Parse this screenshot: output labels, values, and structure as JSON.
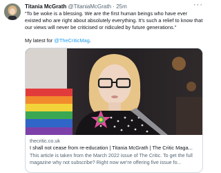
{
  "tweet": {
    "author_name": "Titania McGrath",
    "author_handle": "@TitaniaMcGrath",
    "separator": "·",
    "time": "25m",
    "more_icon": "more-horizontal-icon",
    "text_paragraph_1": "“To be woke is a blessing. We are the first human beings who have ever existed who are right about absolutely everything. It’s such a relief to know that our views will never be criticised or ridiculed by future generations.”",
    "text_prefix": "My latest for ",
    "mention": "@TheCriticMag",
    "text_suffix": "."
  },
  "card": {
    "domain": "thecritic.co.uk",
    "title": "I shall not cease from re-education | Titania McGrath | The Critic Maga...",
    "description": "This article is taken from the March 2022 issue of The Critic. To get the full magazine why not subscribe? Right now we’re offering five issue fo..."
  },
  "colors": {
    "link": "#1d9bf0",
    "secondary_text": "#536471",
    "card_border": "#cfd9de"
  }
}
